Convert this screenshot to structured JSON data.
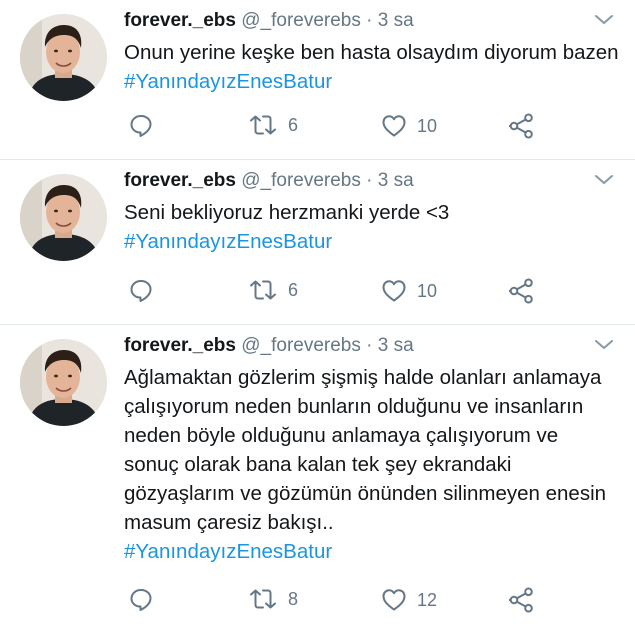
{
  "tweets": [
    {
      "name": "forever._ebs",
      "handle": "@_foreverebs",
      "separator": "·",
      "time": "3 sa",
      "text": "Onun yerine keşke ben hasta olsaydım diyorum bazen",
      "hashtag": "#YanındayızEnesBatur",
      "retweets": "6",
      "likes": "10"
    },
    {
      "name": "forever._ebs",
      "handle": "@_foreverebs",
      "separator": "·",
      "time": "3 sa",
      "text": "Seni bekliyoruz herzmanki yerde <3",
      "hashtag": "#YanındayızEnesBatur",
      "retweets": "6",
      "likes": "10"
    },
    {
      "name": "forever._ebs",
      "handle": "@_foreverebs",
      "separator": "·",
      "time": "3 sa",
      "text": "Ağlamaktan gözlerim şişmiş halde olanları anlamaya çalışıyorum neden bunların olduğunu ve insanların neden böyle olduğunu anlamaya çalışıyorum ve sonuç olarak bana kalan tek şey ekrandaki gözyaşlarım ve gözümün önünden silinmeyen enesin masum çaresiz bakışı..",
      "hashtag": "#YanındayızEnesBatur",
      "retweets": "8",
      "likes": "12"
    }
  ],
  "colors": {
    "text": "#14171a",
    "muted": "#657786",
    "link": "#1b95e0",
    "divider": "#e1e8ed"
  },
  "icons": [
    "avatar-photo",
    "chevron-down-icon",
    "reply-icon",
    "retweet-icon",
    "like-icon",
    "share-icon"
  ]
}
